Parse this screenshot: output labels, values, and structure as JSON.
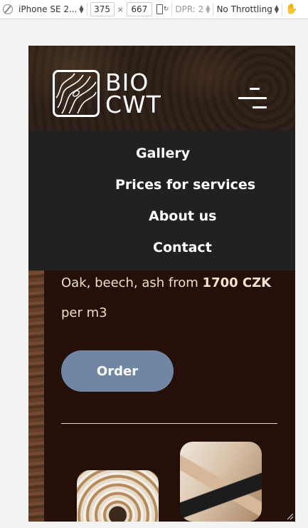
{
  "devtools": {
    "device": "iPhone SE 2...",
    "width": "375",
    "times": "×",
    "height": "667",
    "dpr": "DPR: 2",
    "throttling": "No Throttling"
  },
  "site": {
    "logo_line1": "BIO",
    "logo_line2": "CWT",
    "menu": [
      "Gallery",
      "Prices for services",
      "About us",
      "Contact"
    ],
    "price_prefix": "Oak, beech, ash from ",
    "price_value": "1700 CZK",
    "price_unit": "per m3",
    "order_label": "Order"
  },
  "colors": {
    "menu_bg": "#212121",
    "content_bg": "#241008",
    "button": "#7185a5",
    "text_light": "#f2dcc6"
  }
}
